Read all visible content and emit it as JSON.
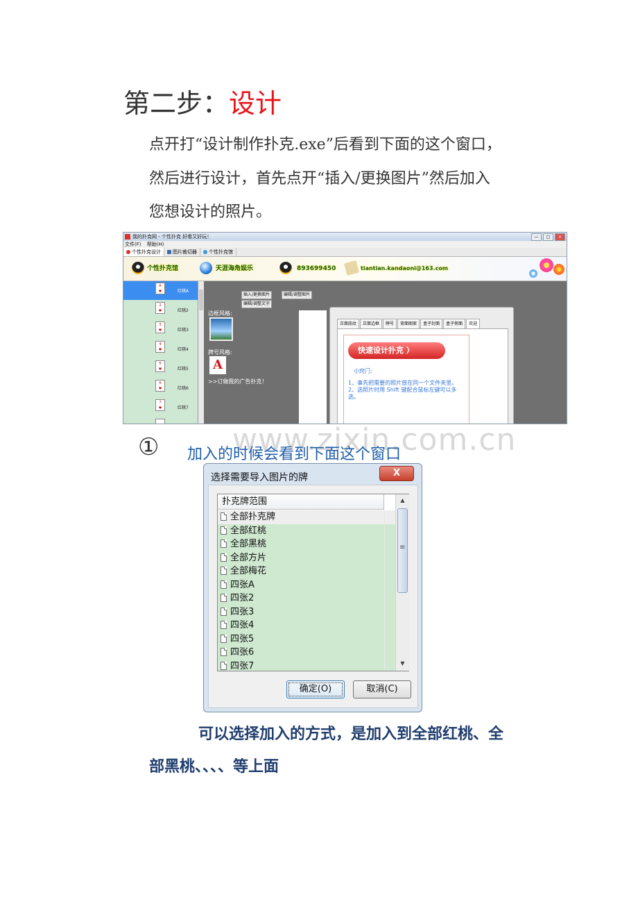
{
  "heading": {
    "prefix": "第二步：",
    "highlight": "设计"
  },
  "intro": {
    "line1": "点开打“设计制作扑克.exe”后看到下面的这个窗口，",
    "line2": "然后进行设计，首先点开“插入/更换图片”然后加入",
    "line3": "您想设计的照片。"
  },
  "app": {
    "title": "我的扑克网 - 个性扑克 好看又好玩！",
    "window_buttons": [
      "—",
      "□",
      "×"
    ],
    "menu": [
      "文件(F)",
      "帮助(H)"
    ],
    "tabs": [
      "个性扑克设计",
      "图片裁切器",
      "个性扑克馆"
    ],
    "banner": {
      "item1": "个性扑克馆",
      "item2": "天涯海角娱乐",
      "item3": "893699450",
      "item4": "tiantian.kandaoni@163.com"
    },
    "sidebar": [
      "红桃A",
      "红桃2",
      "红桃3",
      "红桃4",
      "红桃5",
      "红桃6",
      "红桃7",
      ""
    ],
    "buttons": {
      "insert": "插入/更换图片",
      "edit": "编辑/调整图片",
      "edit_text": "编辑/调整文字"
    },
    "border_style_label": "边框风格:",
    "rank_style_label": "牌号风格:",
    "rank_letter": "A",
    "ad_link": ">>订做我的广告扑克！",
    "dialog_tabs": [
      "正面底纹",
      "正面边框",
      "牌号",
      "背面图案",
      "盒子封面",
      "盒子侧面",
      "欢迎"
    ],
    "quick_button": "快速设计扑克 〉",
    "tip_title": "小窍门:",
    "tip_text": "1、事先把需要的照片放在同一个文件夹里。 2、选照片时用 Shift 键配合鼠标左键可以多选。"
  },
  "step": {
    "number": "①",
    "caption": "加入的时候会看到下面这个窗口"
  },
  "watermark": "www.zixin.com.cn",
  "import_dialog": {
    "title": "选择需要导入图片的牌",
    "close": "X",
    "column_header": "扑克牌范围",
    "rows": [
      "全部扑克牌",
      "全部红桃",
      "全部黑桃",
      "全部方片",
      "全部梅花",
      "四张A",
      "四张2",
      "四张3",
      "四张4",
      "四张5",
      "四张6",
      "四张7"
    ],
    "ok": "确定(O)",
    "cancel": "取消(C)",
    "scroll_up": "▲",
    "scroll_down": "▼",
    "scroll_grip": "≡"
  },
  "closing": {
    "line1": "可以选择加入的方式，是加入到全部红桃、全",
    "line2": "部黑桃、、、、等上面"
  }
}
